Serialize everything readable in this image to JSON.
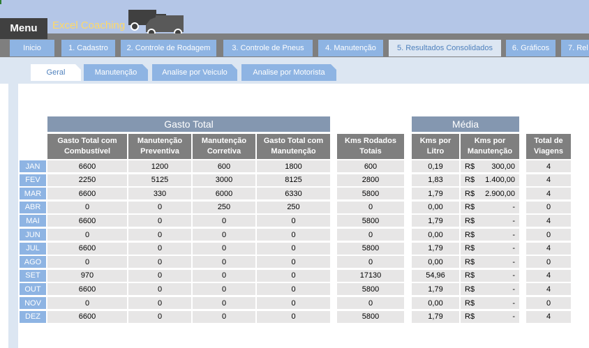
{
  "header": {
    "menu_label": "Menu",
    "brand": "Excel Coaching"
  },
  "tabs": [
    {
      "label": "Inicio"
    },
    {
      "label": "1. Cadastro"
    },
    {
      "label": "2. Controle de Rodagem"
    },
    {
      "label": "3. Controle de Pneus"
    },
    {
      "label": "4. Manutenção"
    },
    {
      "label": "5. Resultados Consolidados"
    },
    {
      "label": "6. Gráficos"
    },
    {
      "label": "7. Rel"
    }
  ],
  "subtabs": [
    {
      "label": "Geral"
    },
    {
      "label": "Manutenção"
    },
    {
      "label": "Analise por Veiculo"
    },
    {
      "label": "Analise por Motorista"
    }
  ],
  "groups": {
    "gasto_total": "Gasto Total",
    "media": "Média"
  },
  "columns": [
    "Gasto Total com Combustível",
    "Manutenção Preventiva",
    "Manutenção Corretiva",
    "Gasto Total com Manutenção",
    "Kms Rodados Totais",
    "Kms por Litro",
    "Kms por Manutenção",
    "Total de Viagens"
  ],
  "currency": "R$",
  "rows": [
    {
      "month": "JAN",
      "gc": "6600",
      "mp": "1200",
      "mc": "600",
      "gm": "1800",
      "km": "600",
      "kl": "0,19",
      "kmm": "300,00",
      "tv": "4"
    },
    {
      "month": "FEV",
      "gc": "2250",
      "mp": "5125",
      "mc": "3000",
      "gm": "8125",
      "km": "2800",
      "kl": "1,83",
      "kmm": "1.400,00",
      "tv": "4"
    },
    {
      "month": "MAR",
      "gc": "6600",
      "mp": "330",
      "mc": "6000",
      "gm": "6330",
      "km": "5800",
      "kl": "1,79",
      "kmm": "2.900,00",
      "tv": "4"
    },
    {
      "month": "ABR",
      "gc": "0",
      "mp": "0",
      "mc": "250",
      "gm": "250",
      "km": "0",
      "kl": "0,00",
      "kmm": "-",
      "tv": "0"
    },
    {
      "month": "MAI",
      "gc": "6600",
      "mp": "0",
      "mc": "0",
      "gm": "0",
      "km": "5800",
      "kl": "1,79",
      "kmm": "-",
      "tv": "4"
    },
    {
      "month": "JUN",
      "gc": "0",
      "mp": "0",
      "mc": "0",
      "gm": "0",
      "km": "0",
      "kl": "0,00",
      "kmm": "-",
      "tv": "0"
    },
    {
      "month": "JUL",
      "gc": "6600",
      "mp": "0",
      "mc": "0",
      "gm": "0",
      "km": "5800",
      "kl": "1,79",
      "kmm": "-",
      "tv": "4"
    },
    {
      "month": "AGO",
      "gc": "0",
      "mp": "0",
      "mc": "0",
      "gm": "0",
      "km": "0",
      "kl": "0,00",
      "kmm": "-",
      "tv": "0"
    },
    {
      "month": "SET",
      "gc": "970",
      "mp": "0",
      "mc": "0",
      "gm": "0",
      "km": "17130",
      "kl": "54,96",
      "kmm": "-",
      "tv": "4"
    },
    {
      "month": "OUT",
      "gc": "6600",
      "mp": "0",
      "mc": "0",
      "gm": "0",
      "km": "5800",
      "kl": "1,79",
      "kmm": "-",
      "tv": "4"
    },
    {
      "month": "NOV",
      "gc": "0",
      "mp": "0",
      "mc": "0",
      "gm": "0",
      "km": "0",
      "kl": "0,00",
      "kmm": "-",
      "tv": "0"
    },
    {
      "month": "DEZ",
      "gc": "6600",
      "mp": "0",
      "mc": "0",
      "gm": "0",
      "km": "5800",
      "kl": "1,79",
      "kmm": "-",
      "tv": "4"
    }
  ]
}
